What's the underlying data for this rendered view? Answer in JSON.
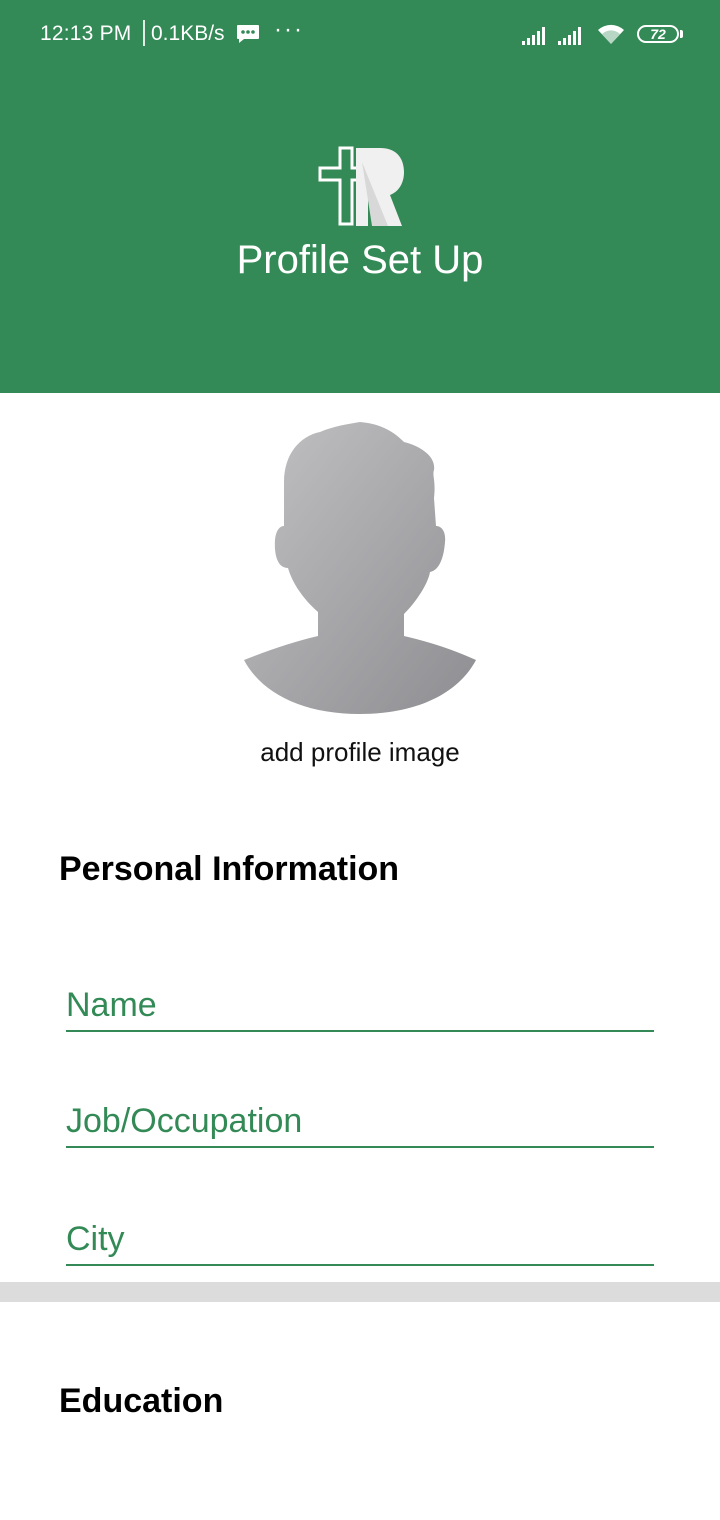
{
  "status_bar": {
    "time": "12:13 PM",
    "net_speed": "0.1KB/s",
    "more": "···",
    "battery": "72"
  },
  "header": {
    "title": "Profile Set Up",
    "background": "#338a56"
  },
  "avatar": {
    "caption": "add profile image"
  },
  "personal": {
    "heading": "Personal Information",
    "name_placeholder": "Name",
    "job_placeholder": "Job/Occupation",
    "city_placeholder": "City"
  },
  "education": {
    "heading": "Education"
  },
  "colors": {
    "accent": "#338a56",
    "divider": "#dcdcdc"
  },
  "icons": [
    "message-icon",
    "signal-icon",
    "wifi-icon",
    "battery-icon",
    "app-logo-icon",
    "avatar-placeholder-icon"
  ]
}
